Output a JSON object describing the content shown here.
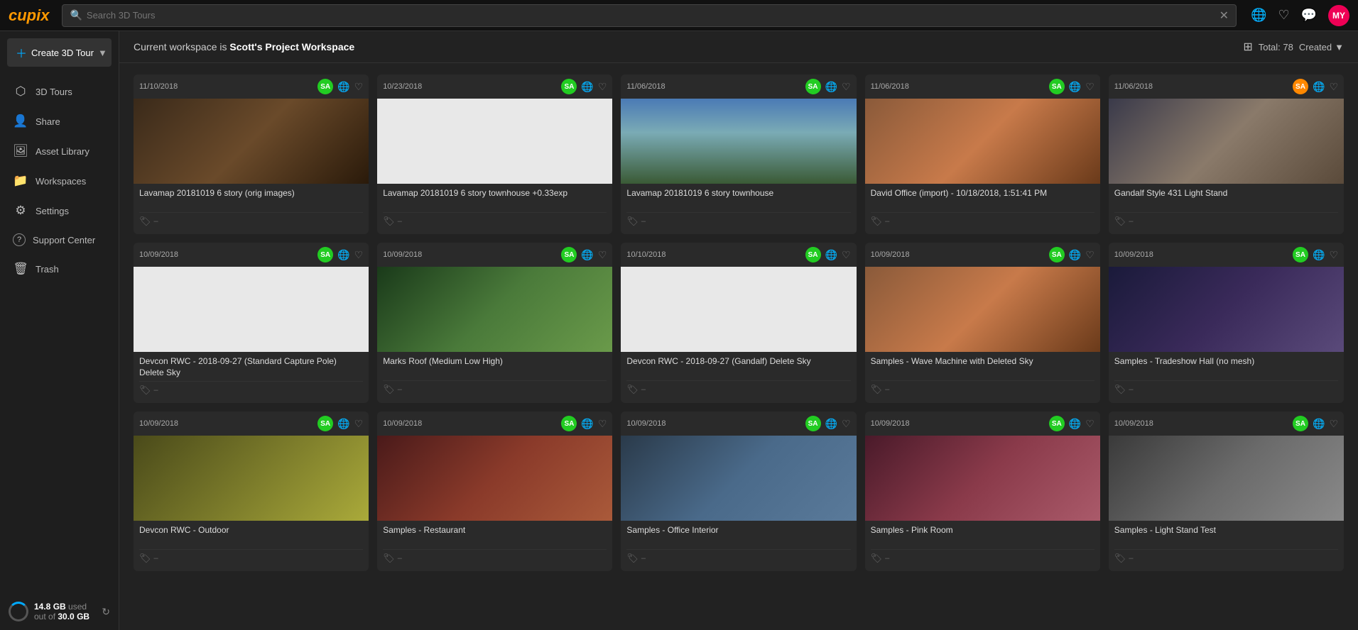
{
  "app": {
    "logo": "cupix",
    "search_placeholder": "Search 3D Tours",
    "search_value": "Search 3D Tours"
  },
  "topbar": {
    "globe_icon": "🌐",
    "heart_icon": "♡",
    "message_icon": "💬",
    "avatar_text": "MY"
  },
  "sidebar": {
    "create_label": "Create 3D Tour",
    "items": [
      {
        "id": "3d-tours",
        "icon": "⬡",
        "label": "3D Tours"
      },
      {
        "id": "share",
        "icon": "👤",
        "label": "Share"
      },
      {
        "id": "asset-library",
        "icon": "🖼",
        "label": "Asset Library"
      },
      {
        "id": "workspaces",
        "icon": "📁",
        "label": "Workspaces"
      },
      {
        "id": "settings",
        "icon": "⚙",
        "label": "Settings"
      },
      {
        "id": "support",
        "icon": "?",
        "label": "Support Center"
      },
      {
        "id": "trash",
        "icon": "🗑",
        "label": "Trash"
      }
    ],
    "storage_used": "14.8 GB",
    "storage_label": "used",
    "storage_out_of": "out of",
    "storage_total": "30.0 GB"
  },
  "main": {
    "workspace_prefix": "Current workspace is",
    "workspace_name": "Scott's Project Workspace",
    "total_label": "Total: 78",
    "sort_label": "Created"
  },
  "cards": [
    {
      "date": "11/10/2018",
      "user": "SA",
      "user_color": "green",
      "title": "Lavamap 20181019 6 story (orig images)",
      "thumb_class": "thumb-brown",
      "tag": "–"
    },
    {
      "date": "10/23/2018",
      "user": "SA",
      "user_color": "green",
      "title": "Lavamap 20181019 6 story townhouse +0.33exp",
      "thumb_class": "thumb-white",
      "tag": "–"
    },
    {
      "date": "11/06/2018",
      "user": "SA",
      "user_color": "green",
      "title": "Lavamap 20181019 6 story townhouse",
      "thumb_class": "thumb-sky",
      "tag": "–"
    },
    {
      "date": "11/06/2018",
      "user": "SA",
      "user_color": "green",
      "title": "David Office (import) - 10/18/2018, 1:51:41 PM",
      "thumb_class": "thumb-orange",
      "tag": "–"
    },
    {
      "date": "11/06/2018",
      "user": "SA",
      "user_color": "orange",
      "title": "Gandalf Style 431 Light Stand",
      "thumb_class": "thumb-gandalf",
      "tag": "–"
    },
    {
      "date": "10/09/2018",
      "user": "SA",
      "user_color": "green",
      "title": "Devcon RWC - 2018-09-27 (Standard Capture Pole) Delete Sky",
      "thumb_class": "thumb-white",
      "tag": "–"
    },
    {
      "date": "10/09/2018",
      "user": "SA",
      "user_color": "green",
      "title": "Marks Roof (Medium Low High)",
      "thumb_class": "thumb-green",
      "tag": "–"
    },
    {
      "date": "10/10/2018",
      "user": "SA",
      "user_color": "green",
      "title": "Devcon RWC - 2018-09-27 (Gandalf) Delete Sky",
      "thumb_class": "thumb-white",
      "tag": "–"
    },
    {
      "date": "10/09/2018",
      "user": "SA",
      "user_color": "green",
      "title": "Samples - Wave Machine with Deleted Sky",
      "thumb_class": "thumb-orange",
      "tag": "–"
    },
    {
      "date": "10/09/2018",
      "user": "SA",
      "user_color": "green",
      "title": "Samples - Tradeshow Hall (no mesh)",
      "thumb_class": "thumb-hall",
      "tag": "–"
    },
    {
      "date": "10/09/2018",
      "user": "SA",
      "user_color": "green",
      "title": "Devcon RWC - Outdoor",
      "thumb_class": "thumb-yellow",
      "tag": "–"
    },
    {
      "date": "10/09/2018",
      "user": "SA",
      "user_color": "green",
      "title": "Samples - Restaurant",
      "thumb_class": "thumb-restaurant",
      "tag": "–"
    },
    {
      "date": "10/09/2018",
      "user": "SA",
      "user_color": "green",
      "title": "Samples - Office Interior",
      "thumb_class": "thumb-office",
      "tag": "–"
    },
    {
      "date": "10/09/2018",
      "user": "SA",
      "user_color": "green",
      "title": "Samples - Pink Room",
      "thumb_class": "thumb-pink",
      "tag": "–"
    },
    {
      "date": "10/09/2018",
      "user": "SA",
      "user_color": "green",
      "title": "Samples - Light Stand Test",
      "thumb_class": "thumb-light",
      "tag": "–"
    }
  ]
}
